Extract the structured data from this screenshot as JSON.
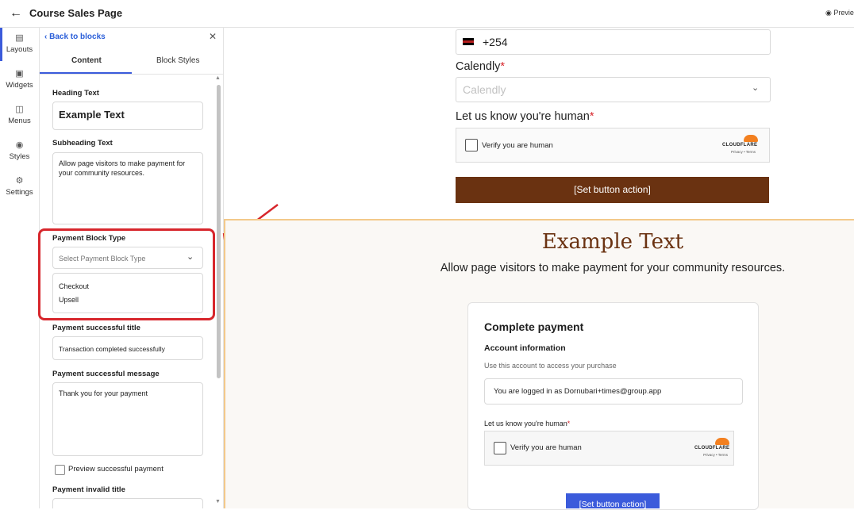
{
  "header": {
    "title": "Course Sales Page",
    "preview_label": "Previe"
  },
  "rail": {
    "items": [
      {
        "label": "Layouts",
        "icon": "layouts-icon"
      },
      {
        "label": "Widgets",
        "icon": "widgets-icon"
      },
      {
        "label": "Menus",
        "icon": "menus-icon"
      },
      {
        "label": "Styles",
        "icon": "styles-icon"
      },
      {
        "label": "Settings",
        "icon": "settings-icon"
      }
    ]
  },
  "panel": {
    "back_label": "Back to blocks",
    "tabs": [
      "Content",
      "Block Styles"
    ],
    "heading_label": "Heading Text",
    "heading_value": "Example Text",
    "subheading_label": "Subheading Text",
    "subheading_value": "Allow page visitors to make payment for your community resources.",
    "payment_type_label": "Payment Block Type",
    "payment_type_placeholder": "Select Payment Block Type",
    "payment_type_options": [
      "Checkout",
      "Upsell"
    ],
    "success_title_label": "Payment successful title",
    "success_title_value": "Transaction completed successfully",
    "success_msg_label": "Payment successful message",
    "success_msg_value": "Thank you for your payment",
    "preview_checkbox_label": "Preview successful payment",
    "invalid_title_label": "Payment invalid title"
  },
  "form": {
    "phone_value": "+254",
    "calendly_label": "Calendly",
    "calendly_placeholder": "Calendly",
    "human_label": "Let us know you're human",
    "verify_text": "Verify you are human",
    "cf_logo": "CLOUDFLARE",
    "cf_terms": "Privacy • Terms",
    "button_label": "[Set button action]",
    "required_mark": "*"
  },
  "payment_section": {
    "title": "Example Text",
    "subtitle": "Allow page visitors to make payment for your community resources.",
    "card_title": "Complete payment",
    "account_info": "Account information",
    "account_desc": "Use this account to access your purchase",
    "logged_in_text": "You are logged in as Dornubari+times@group.app",
    "human_label": "Let us know you're human",
    "verify_text": "Verify you are human",
    "button_label": "[Set button action]"
  },
  "colors": {
    "accent": "#3b5bdb",
    "brown": "#6a3211",
    "highlight_red": "#d7262c"
  }
}
